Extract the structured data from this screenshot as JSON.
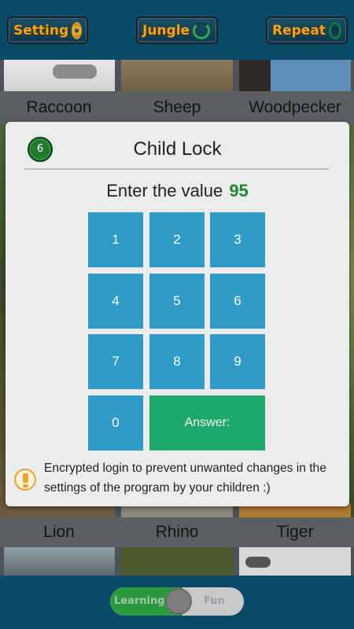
{
  "topbar": {
    "setting_label": "Setting",
    "jungle_label": "Jungle",
    "repeat_label": "Repeat"
  },
  "animals_row1": [
    "Raccoon",
    "Sheep",
    "Woodpecker"
  ],
  "animals_row2": [
    "Lion",
    "Rhino",
    "Tiger"
  ],
  "modal": {
    "badge": "6",
    "title": "Child Lock",
    "prompt_prefix": "Enter the value",
    "prompt_value": "95",
    "keys": [
      "1",
      "2",
      "3",
      "4",
      "5",
      "6",
      "7",
      "8",
      "9",
      "0"
    ],
    "answer_label": "Answer:",
    "note": "Encrypted login to prevent unwanted changes in the settings of the program by your children :)"
  },
  "mode_toggle": {
    "left_label": "Learning",
    "right_label": "Fun",
    "state": "Learning"
  },
  "colors": {
    "key_blue": "#2f9bc6",
    "answer_green": "#1ea86a",
    "value_green": "#1f8a2d",
    "topbar_blue": "#0b4a68",
    "button_text_orange": "#e9a623",
    "warning_orange": "#f1a12a"
  }
}
